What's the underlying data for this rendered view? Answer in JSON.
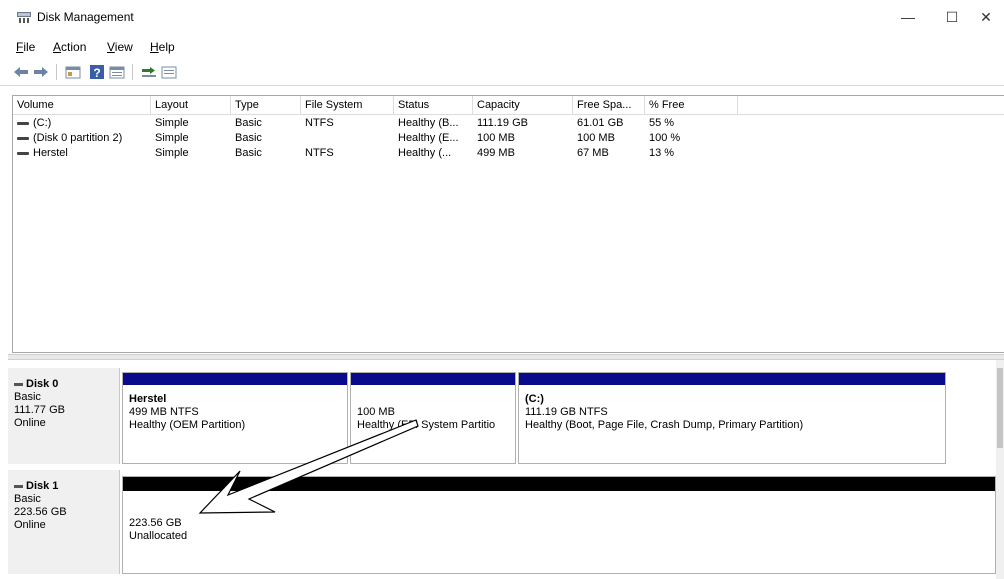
{
  "window": {
    "title": "Disk Management",
    "controls": {
      "minimize": "—",
      "maximize": "☐",
      "close": "✕"
    }
  },
  "menu": {
    "items": [
      {
        "label": "File",
        "accel": "F",
        "rest": "ile"
      },
      {
        "label": "Action",
        "accel": "A",
        "rest": "ction"
      },
      {
        "label": "View",
        "accel": "V",
        "rest": "iew"
      },
      {
        "label": "Help",
        "accel": "H",
        "rest": "elp"
      }
    ]
  },
  "toolbar": {
    "buttons": [
      "back-icon",
      "forward-icon",
      "properties-icon",
      "help-icon",
      "view-icon",
      "connect-icon",
      "list-icon"
    ]
  },
  "volume_table": {
    "columns": [
      "Volume",
      "Layout",
      "Type",
      "File System",
      "Status",
      "Capacity",
      "Free Spa...",
      "% Free"
    ],
    "rows": [
      {
        "volume": "(C:)",
        "layout": "Simple",
        "type": "Basic",
        "fs": "NTFS",
        "status": "Healthy (B...",
        "capacity": "111.19 GB",
        "free": "61.01 GB",
        "pct": "55 %"
      },
      {
        "volume": "(Disk 0 partition 2)",
        "layout": "Simple",
        "type": "Basic",
        "fs": "",
        "status": "Healthy (E...",
        "capacity": "100 MB",
        "free": "100 MB",
        "pct": "100 %"
      },
      {
        "volume": "Herstel",
        "layout": "Simple",
        "type": "Basic",
        "fs": "NTFS",
        "status": "Healthy (...",
        "capacity": "499 MB",
        "free": "67 MB",
        "pct": "13 %"
      }
    ]
  },
  "disks": [
    {
      "name": "Disk 0",
      "kind": "Basic",
      "size": "111.77 GB",
      "state": "Online",
      "partitions": [
        {
          "title": "Herstel",
          "line1": "499 MB NTFS",
          "line2": "Healthy (OEM Partition)"
        },
        {
          "title": "",
          "line1": "100 MB",
          "line2": "Healthy (EFI System Partitio"
        },
        {
          "title": "(C:)",
          "line1": "111.19 GB NTFS",
          "line2": "Healthy (Boot, Page File, Crash Dump, Primary Partition)"
        }
      ]
    },
    {
      "name": "Disk 1",
      "kind": "Basic",
      "size": "223.56 GB",
      "state": "Online",
      "partitions": [
        {
          "title": "",
          "line1": "223.56 GB",
          "line2": "Unallocated"
        }
      ]
    }
  ],
  "colors": {
    "primary_partition": "#0a0a8c",
    "unallocated": "#000000",
    "window_bg": "#ffffff"
  }
}
